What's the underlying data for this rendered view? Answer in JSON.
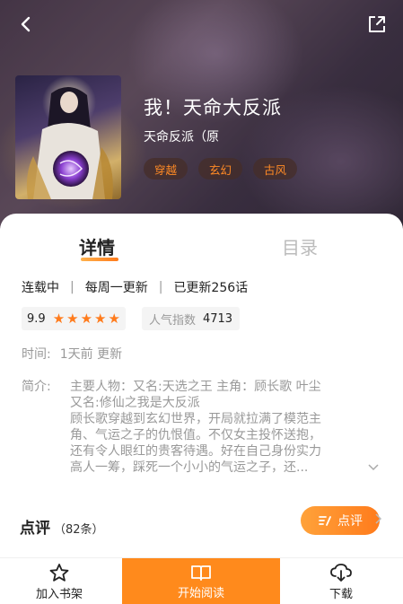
{
  "header": {
    "back_icon": "chevron-left-icon",
    "share_icon": "share-icon"
  },
  "book": {
    "title": "我！天命大反派",
    "author": "天命反派（原",
    "tags": [
      "穿越",
      "玄幻",
      "古风"
    ]
  },
  "tabs": {
    "detail": "详情",
    "toc": "目录"
  },
  "status": {
    "serial": "连载中",
    "schedule": "每周一更新",
    "updated": "已更新256话",
    "separator": "|"
  },
  "rating": {
    "score": "9.9",
    "stars": 5,
    "popularity_label": "人气指数",
    "popularity_value": "4713"
  },
  "time": {
    "label": "时间:",
    "value": "1天前 更新"
  },
  "intro": {
    "label": "简介:",
    "lines": [
      "主要人物：又名:天选之王 主角：顾长歌 叶尘",
      "又名:修仙之我是大反派",
      "顾长歌穿越到玄幻世界，开局就拉满了模范主",
      "角、气运之子的仇恨值。不仅女主投怀送抱，",
      "还有令人眼红的贵客待遇。好在自己身份实力",
      "高人一筹，踩死一个小小的气运之子，还..."
    ],
    "more_icon": "chevron-down-icon"
  },
  "review": {
    "title": "点评",
    "count": "（82条）",
    "button_label": "点评"
  },
  "bottom_bar": {
    "shelf_label": "加入书架",
    "read_label": "开始阅读",
    "download_label": "下载"
  },
  "colors": {
    "accent": "#ff8a1c",
    "star": "#ff7b1c",
    "muted": "#999999"
  }
}
